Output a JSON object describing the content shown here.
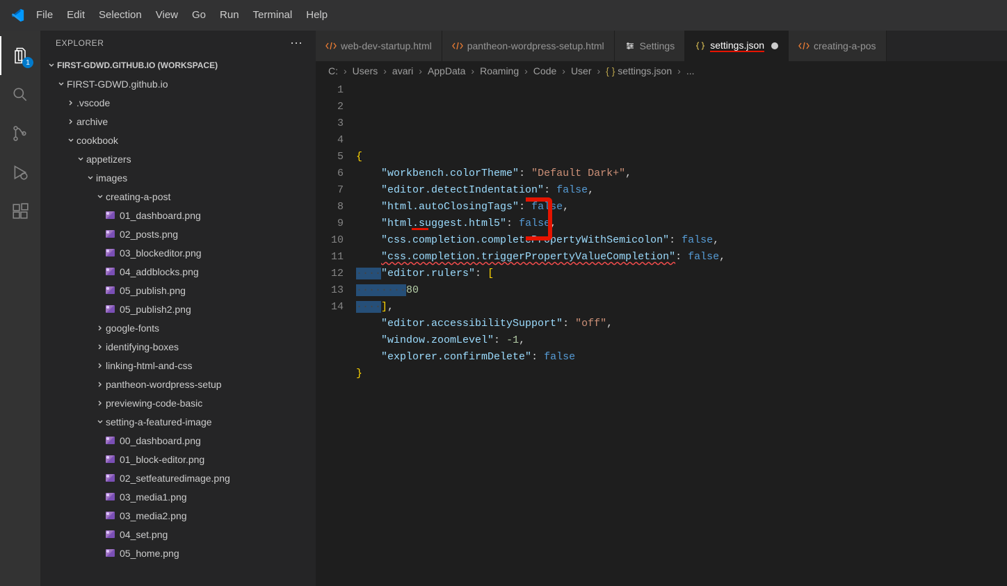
{
  "menubar": [
    "File",
    "Edit",
    "Selection",
    "View",
    "Go",
    "Run",
    "Terminal",
    "Help"
  ],
  "activity_badge": "1",
  "sidebar": {
    "title": "EXPLORER",
    "workspace": "FIRST-GDWD.GITHUB.IO (WORKSPACE)",
    "tree": [
      {
        "d": 1,
        "t": "folder",
        "open": true,
        "label": "FIRST-GDWD.github.io"
      },
      {
        "d": 2,
        "t": "folder",
        "open": false,
        "label": ".vscode"
      },
      {
        "d": 2,
        "t": "folder",
        "open": false,
        "label": "archive"
      },
      {
        "d": 2,
        "t": "folder",
        "open": true,
        "label": "cookbook"
      },
      {
        "d": 3,
        "t": "folder",
        "open": true,
        "label": "appetizers"
      },
      {
        "d": 4,
        "t": "folder",
        "open": true,
        "label": "images"
      },
      {
        "d": 5,
        "t": "folder",
        "open": true,
        "label": "creating-a-post"
      },
      {
        "d": 6,
        "t": "file",
        "label": "01_dashboard.png"
      },
      {
        "d": 6,
        "t": "file",
        "label": "02_posts.png"
      },
      {
        "d": 6,
        "t": "file",
        "label": "03_blockeditor.png"
      },
      {
        "d": 6,
        "t": "file",
        "label": "04_addblocks.png"
      },
      {
        "d": 6,
        "t": "file",
        "label": "05_publish.png"
      },
      {
        "d": 6,
        "t": "file",
        "label": "05_publish2.png"
      },
      {
        "d": 5,
        "t": "folder",
        "open": false,
        "label": "google-fonts"
      },
      {
        "d": 5,
        "t": "folder",
        "open": false,
        "label": "identifying-boxes"
      },
      {
        "d": 5,
        "t": "folder",
        "open": false,
        "label": "linking-html-and-css"
      },
      {
        "d": 5,
        "t": "folder",
        "open": false,
        "label": "pantheon-wordpress-setup"
      },
      {
        "d": 5,
        "t": "folder",
        "open": false,
        "label": "previewing-code-basic"
      },
      {
        "d": 5,
        "t": "folder",
        "open": true,
        "label": "setting-a-featured-image"
      },
      {
        "d": 6,
        "t": "file",
        "label": "00_dashboard.png"
      },
      {
        "d": 6,
        "t": "file",
        "label": "01_block-editor.png"
      },
      {
        "d": 6,
        "t": "file",
        "label": "02_setfeaturedimage.png"
      },
      {
        "d": 6,
        "t": "file",
        "label": "03_media1.png"
      },
      {
        "d": 6,
        "t": "file",
        "label": "03_media2.png"
      },
      {
        "d": 6,
        "t": "file",
        "label": "04_set.png"
      },
      {
        "d": 6,
        "t": "file",
        "label": "05_home.png"
      }
    ]
  },
  "tabs": [
    {
      "icon": "html",
      "label": "web-dev-startup.html",
      "active": false
    },
    {
      "icon": "html",
      "label": "pantheon-wordpress-setup.html",
      "active": false
    },
    {
      "icon": "settings",
      "label": "Settings",
      "active": false
    },
    {
      "icon": "json",
      "label": "settings.json",
      "active": true,
      "unsaved": true,
      "annot": true
    },
    {
      "icon": "html",
      "label": "creating-a-pos",
      "active": false
    }
  ],
  "breadcrumbs": [
    "C:",
    "Users",
    "avari",
    "AppData",
    "Roaming",
    "Code",
    "User",
    "settings.json",
    "..."
  ],
  "code": {
    "lines": 14,
    "content": [
      [
        {
          "t": "brace",
          "v": "{"
        }
      ],
      [
        {
          "t": "ind",
          "v": "    "
        },
        {
          "t": "key",
          "v": "\"workbench.colorTheme\""
        },
        {
          "t": "punc",
          "v": ": "
        },
        {
          "t": "str",
          "v": "\"Default Dark+\""
        },
        {
          "t": "punc",
          "v": ","
        }
      ],
      [
        {
          "t": "ind",
          "v": "    "
        },
        {
          "t": "key",
          "v": "\"editor.detectIndentation\""
        },
        {
          "t": "punc",
          "v": ": "
        },
        {
          "t": "bool",
          "v": "false"
        },
        {
          "t": "punc",
          "v": ","
        }
      ],
      [
        {
          "t": "ind",
          "v": "    "
        },
        {
          "t": "key",
          "v": "\"html.autoClosingTags\""
        },
        {
          "t": "punc",
          "v": ": "
        },
        {
          "t": "bool",
          "v": "false"
        },
        {
          "t": "punc",
          "v": ","
        }
      ],
      [
        {
          "t": "ind",
          "v": "    "
        },
        {
          "t": "key",
          "v": "\"html.suggest.html5\""
        },
        {
          "t": "punc",
          "v": ": "
        },
        {
          "t": "bool",
          "v": "false"
        },
        {
          "t": "punc",
          "v": ","
        }
      ],
      [
        {
          "t": "ind",
          "v": "    "
        },
        {
          "t": "key",
          "v": "\"css.completion.completePropertyWithSemicolon\""
        },
        {
          "t": "punc",
          "v": ": "
        },
        {
          "t": "bool",
          "v": "false"
        },
        {
          "t": "punc",
          "v": ","
        }
      ],
      [
        {
          "t": "ind",
          "v": "    "
        },
        {
          "t": "key",
          "v": "\"css.completion.triggerPropertyValueCompletion\""
        },
        {
          "t": "punc",
          "v": ": "
        },
        {
          "t": "bool",
          "v": "false"
        },
        {
          "t": "punc",
          "v": ","
        }
      ],
      [
        {
          "t": "sel",
          "v": "    "
        },
        {
          "t": "key",
          "v": "\"editor.rulers\""
        },
        {
          "t": "punc",
          "v": ": "
        },
        {
          "t": "brace",
          "v": "["
        }
      ],
      [
        {
          "t": "sel",
          "v": "        "
        },
        {
          "t": "num",
          "v": "80"
        }
      ],
      [
        {
          "t": "sel",
          "v": "    "
        },
        {
          "t": "brace",
          "v": "]"
        },
        {
          "t": "punc",
          "v": ","
        }
      ],
      [
        {
          "t": "ind",
          "v": "    "
        },
        {
          "t": "key",
          "v": "\"editor.accessibilitySupport\""
        },
        {
          "t": "punc",
          "v": ": "
        },
        {
          "t": "str",
          "v": "\"off\""
        },
        {
          "t": "punc",
          "v": ","
        }
      ],
      [
        {
          "t": "ind",
          "v": "    "
        },
        {
          "t": "key",
          "v": "\"window.zoomLevel\""
        },
        {
          "t": "punc",
          "v": ": "
        },
        {
          "t": "num",
          "v": "-1"
        },
        {
          "t": "punc",
          "v": ","
        }
      ],
      [
        {
          "t": "ind",
          "v": "    "
        },
        {
          "t": "key",
          "v": "\"explorer.confirmDelete\""
        },
        {
          "t": "punc",
          "v": ": "
        },
        {
          "t": "bool",
          "v": "false"
        }
      ],
      [
        {
          "t": "brace",
          "v": "}"
        }
      ]
    ]
  }
}
